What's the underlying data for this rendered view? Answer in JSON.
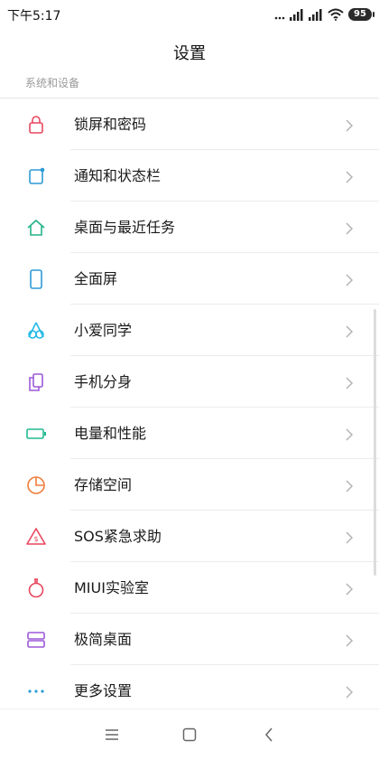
{
  "status_bar": {
    "time": "下午5:17",
    "battery": "95"
  },
  "header": {
    "title": "设置"
  },
  "section": {
    "label": "系统和设备"
  },
  "items": [
    {
      "label": "锁屏和密码",
      "icon": "lock-icon",
      "color": "#e8475f"
    },
    {
      "label": "通知和状态栏",
      "icon": "notification-icon",
      "color": "#2d9ad6"
    },
    {
      "label": "桌面与最近任务",
      "icon": "home-icon",
      "color": "#24b38a"
    },
    {
      "label": "全面屏",
      "icon": "fullscreen-phone-icon",
      "color": "#2d9ad6"
    },
    {
      "label": "小爱同学",
      "icon": "xiaoai-icon",
      "color": "#22b9e6"
    },
    {
      "label": "手机分身",
      "icon": "dual-phone-icon",
      "color": "#9b59d9"
    },
    {
      "label": "电量和性能",
      "icon": "battery-icon",
      "color": "#20b98f"
    },
    {
      "label": "存储空间",
      "icon": "storage-pie-icon",
      "color": "#ef7d3b"
    },
    {
      "label": "SOS紧急求助",
      "icon": "sos-icon",
      "color": "#e8475f"
    },
    {
      "label": "MIUI实验室",
      "icon": "lab-flask-icon",
      "color": "#e8475f"
    },
    {
      "label": "极简桌面",
      "icon": "simple-desktop-icon",
      "color": "#9b59d9"
    },
    {
      "label": "更多设置",
      "icon": "more-dots-icon",
      "color": "#2d9ad6"
    }
  ],
  "nav_bar": {
    "buttons": [
      "menu-icon",
      "home-square-icon",
      "back-icon"
    ]
  }
}
